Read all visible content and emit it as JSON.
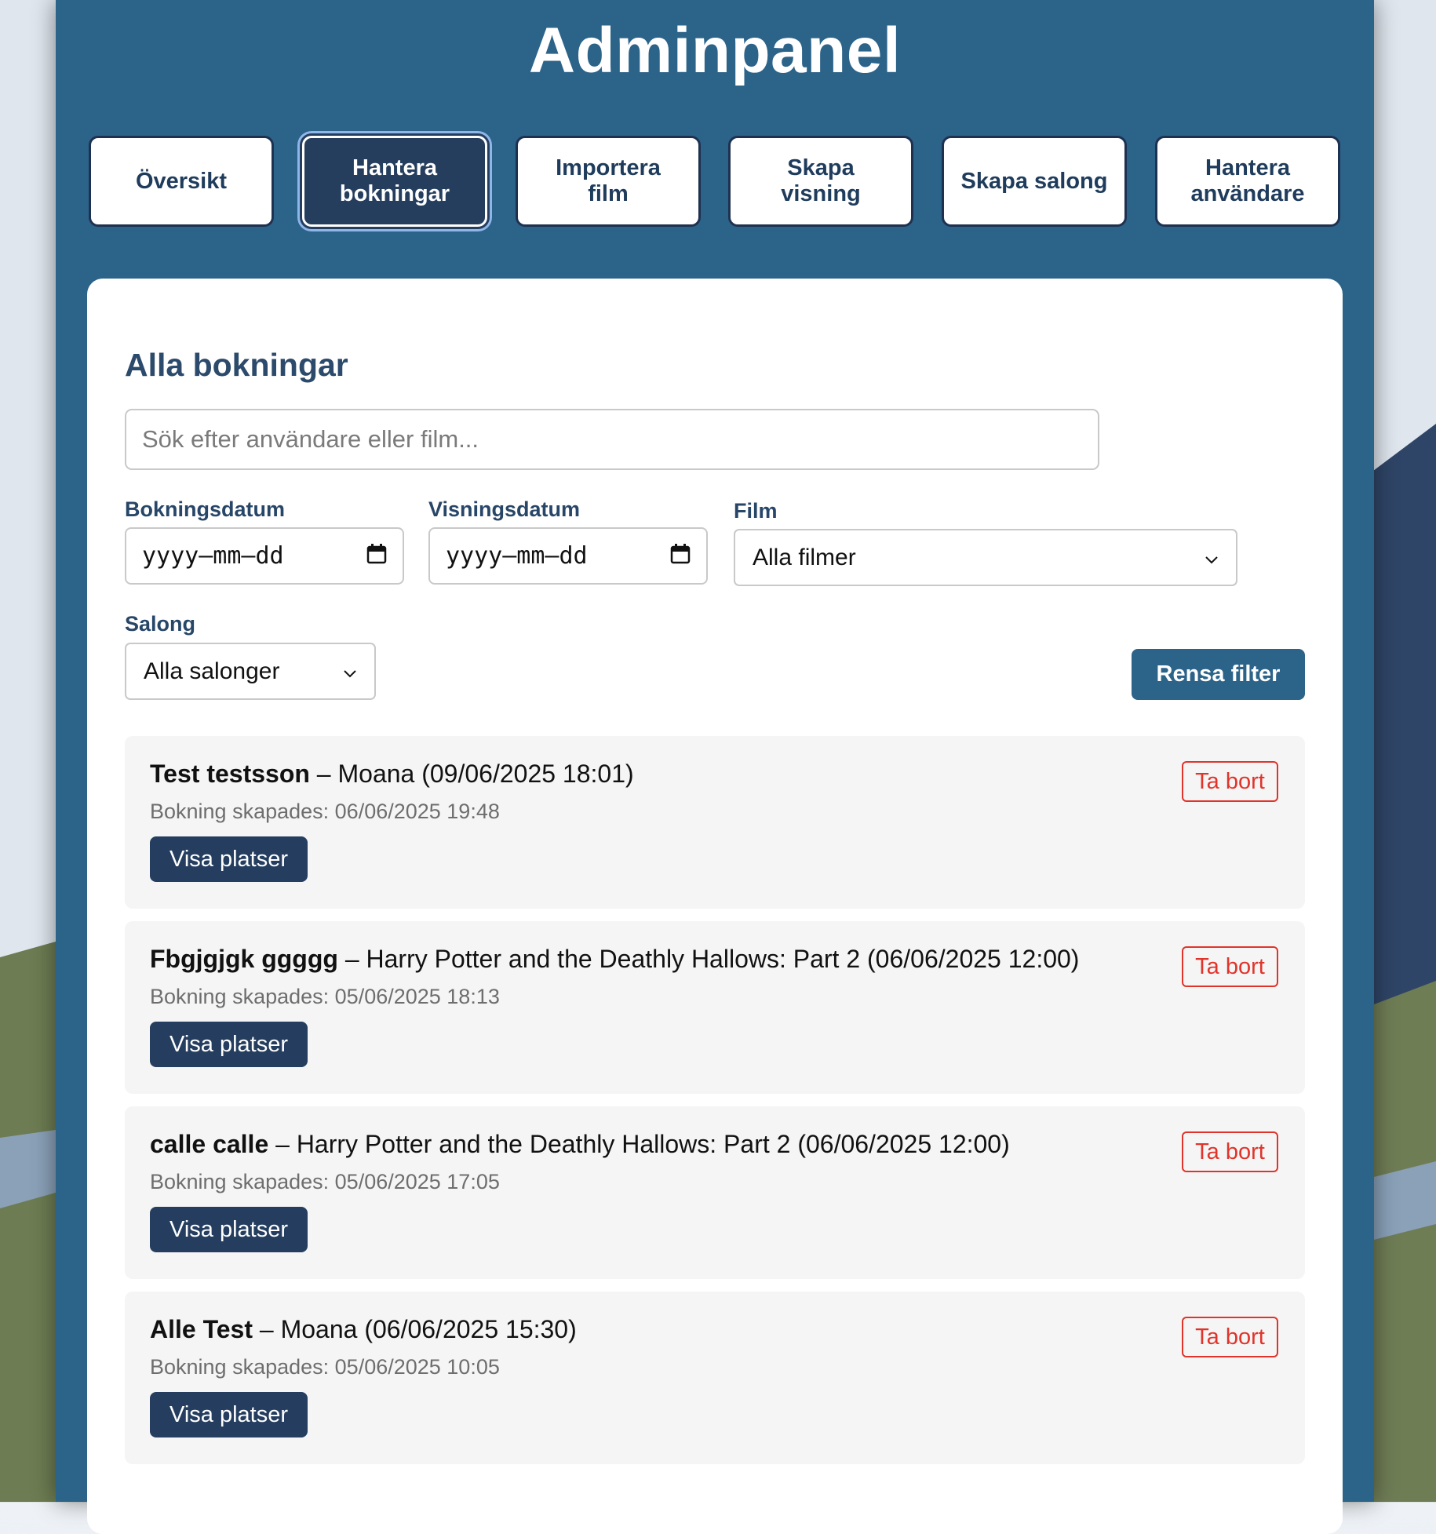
{
  "header": {
    "title": "Adminpanel"
  },
  "nav": {
    "items": [
      {
        "label": "Översikt",
        "active": false
      },
      {
        "label": "Hantera bokningar",
        "active": true
      },
      {
        "label": "Importera film",
        "active": false
      },
      {
        "label": "Skapa visning",
        "active": false
      },
      {
        "label": "Skapa salong",
        "active": false
      },
      {
        "label": "Hantera användare",
        "active": false
      }
    ]
  },
  "bookings_section": {
    "heading": "Alla bokningar",
    "search": {
      "placeholder": "Sök efter användare eller film...",
      "value": ""
    },
    "filters": {
      "booking_date": {
        "label": "Bokningsdatum",
        "value": "yyyy–mm–dd"
      },
      "screening_date": {
        "label": "Visningsdatum",
        "value": "yyyy–mm–dd"
      },
      "film": {
        "label": "Film",
        "value": "Alla filmer"
      },
      "salon": {
        "label": "Salong",
        "value": "Alla salonger"
      },
      "clear_label": "Rensa filter"
    },
    "bookings": [
      {
        "user": "Test testsson",
        "details": " – Moana (09/06/2025 18:01)",
        "created": "Bokning skapades: 06/06/2025 19:48",
        "seats_label": "Visa platser",
        "delete_label": "Ta bort"
      },
      {
        "user": "Fbgjgjgk ggggg",
        "details": " – Harry Potter and the Deathly Hallows: Part 2 (06/06/2025 12:00)",
        "created": "Bokning skapades: 05/06/2025 18:13",
        "seats_label": "Visa platser",
        "delete_label": "Ta bort"
      },
      {
        "user": "calle calle",
        "details": " – Harry Potter and the Deathly Hallows: Part 2 (06/06/2025 12:00)",
        "created": "Bokning skapades: 05/06/2025 17:05",
        "seats_label": "Visa platser",
        "delete_label": "Ta bort"
      },
      {
        "user": "Alle Test",
        "details": " – Moana (06/06/2025 15:30)",
        "created": "Bokning skapades: 05/06/2025 10:05",
        "seats_label": "Visa platser",
        "delete_label": "Ta bort"
      }
    ]
  },
  "colors": {
    "panel": "#2c6389",
    "active_nav": "#263e5e",
    "primary_button": "#253e5f",
    "danger": "#e0342b",
    "heading": "#2c4a6b"
  },
  "icons": {
    "date_picker": "calendar-icon",
    "dropdown": "chevron-down-icon"
  }
}
